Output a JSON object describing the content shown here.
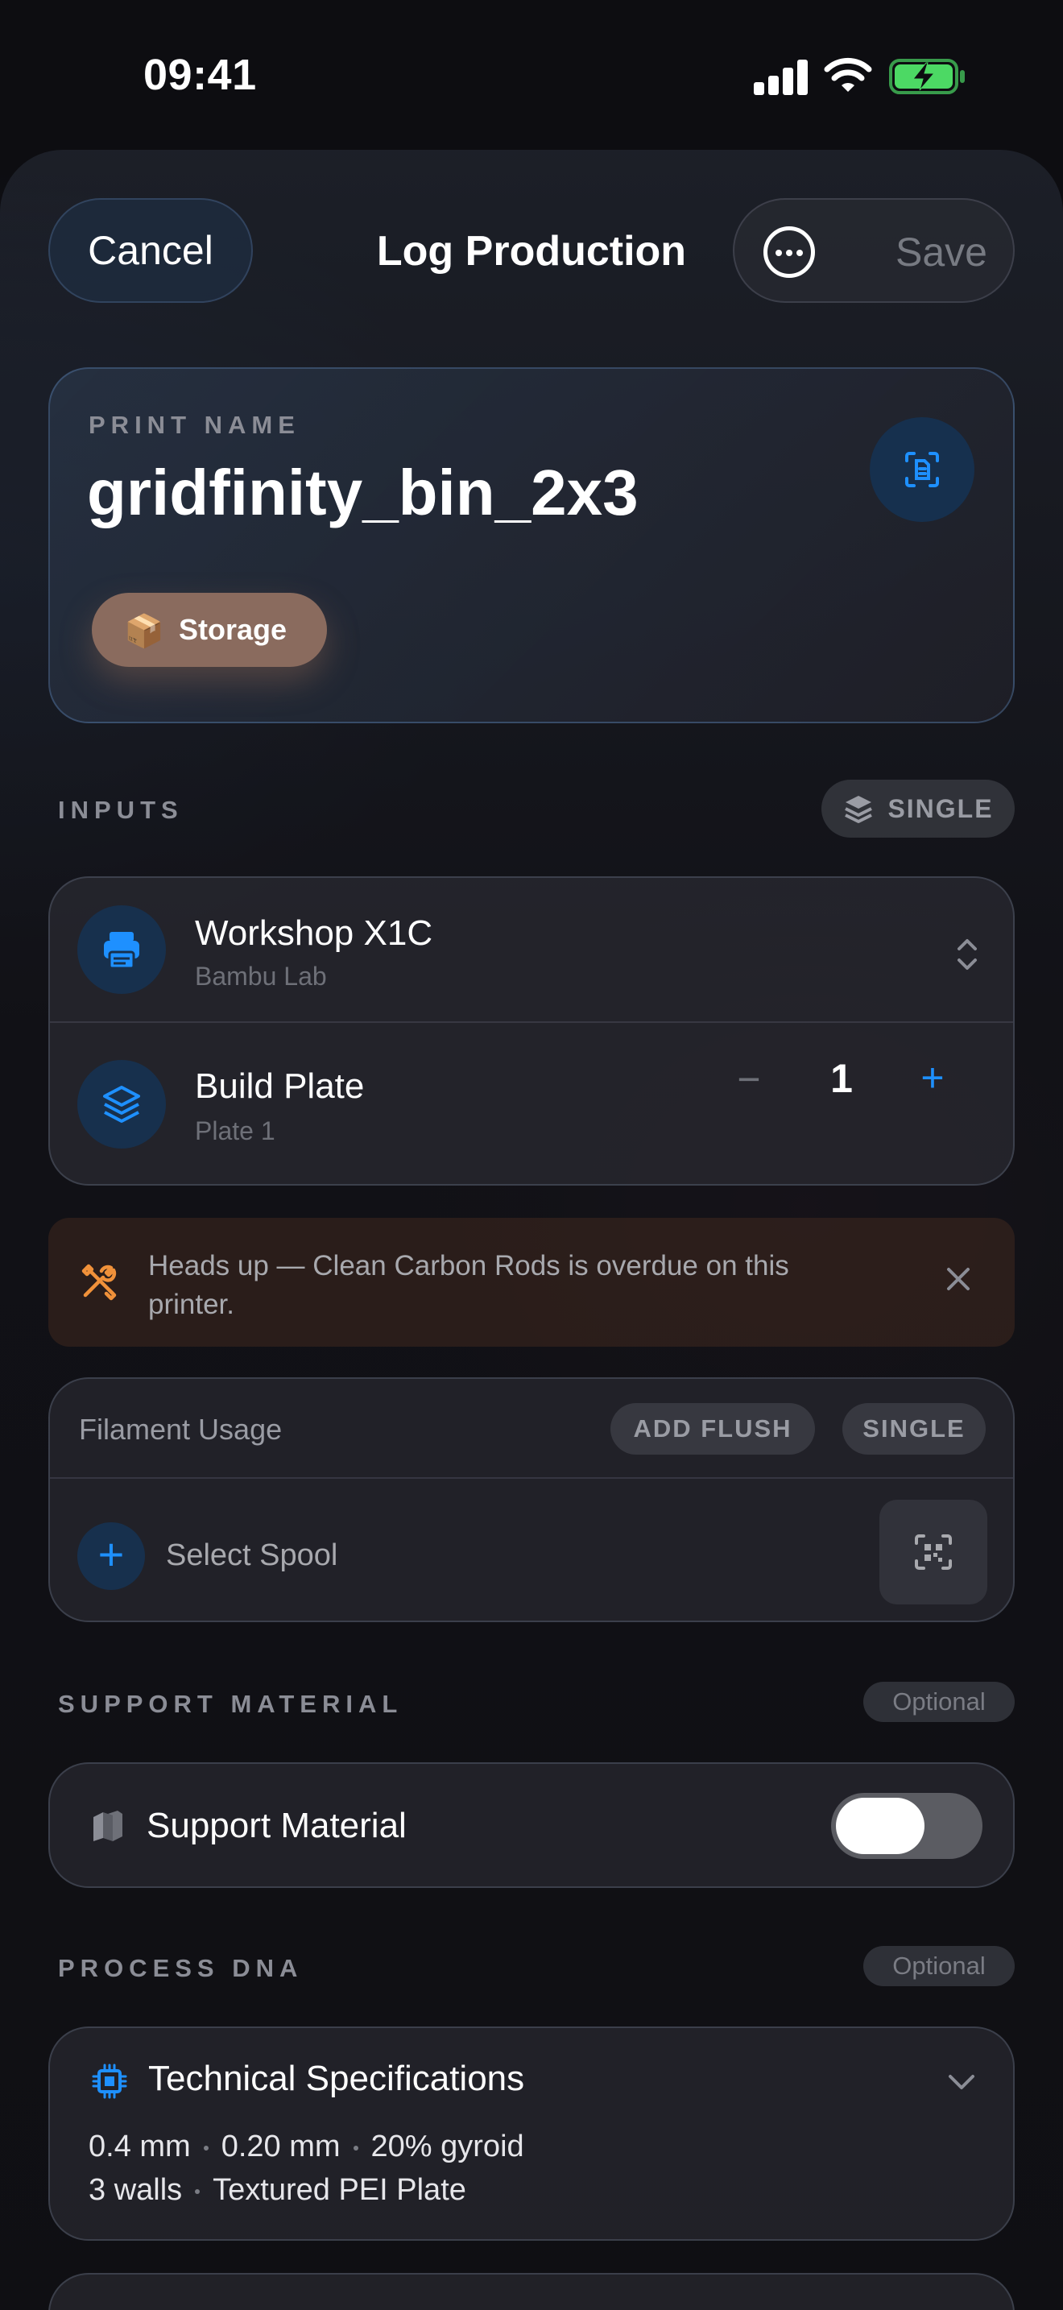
{
  "status_bar": {
    "time": "09:41"
  },
  "nav": {
    "cancel_label": "Cancel",
    "title": "Log Production",
    "save_label": "Save"
  },
  "print": {
    "caption": "PRINT NAME",
    "name": "gridfinity_bin_2x3",
    "tag_emoji": "📦",
    "tag_label": "Storage"
  },
  "inputs": {
    "section_title": "INPUTS",
    "mode_label": "SINGLE",
    "printer": {
      "name": "Workshop X1C",
      "brand": "Bambu Lab"
    },
    "plate": {
      "title": "Build Plate",
      "subtitle": "Plate 1",
      "minus": "−",
      "value": "1",
      "plus": "+"
    }
  },
  "warning": {
    "text": "Heads up — Clean Carbon Rods is overdue on this printer."
  },
  "filament": {
    "title": "Filament Usage",
    "add_flush_label": "ADD FLUSH",
    "single_label": "SINGLE",
    "plus": "+",
    "select_spool_label": "Select Spool"
  },
  "support": {
    "section_title": "SUPPORT MATERIAL",
    "optional_label": "Optional",
    "label": "Support Material",
    "enabled": false
  },
  "process": {
    "section_title": "PROCESS DNA",
    "optional_label": "Optional",
    "spec_title": "Technical Specifications",
    "nozzle": "0.4 mm",
    "layer_height": "0.20 mm",
    "infill": "20% gyroid",
    "walls": "3 walls",
    "plate_type": "Textured PEI Plate"
  },
  "colors": {
    "accent": "#1e90ff",
    "tag_bg": "#8a6b5e",
    "warning_icon": "#f0913a",
    "battery_green": "#4cd964"
  },
  "icons": {
    "printer": "printer-icon",
    "plate": "layers-icon",
    "scan": "document-scan-icon",
    "qr": "qr-scan-icon",
    "warning": "tools-icon",
    "support": "cubes-icon",
    "spec": "chip-icon"
  }
}
